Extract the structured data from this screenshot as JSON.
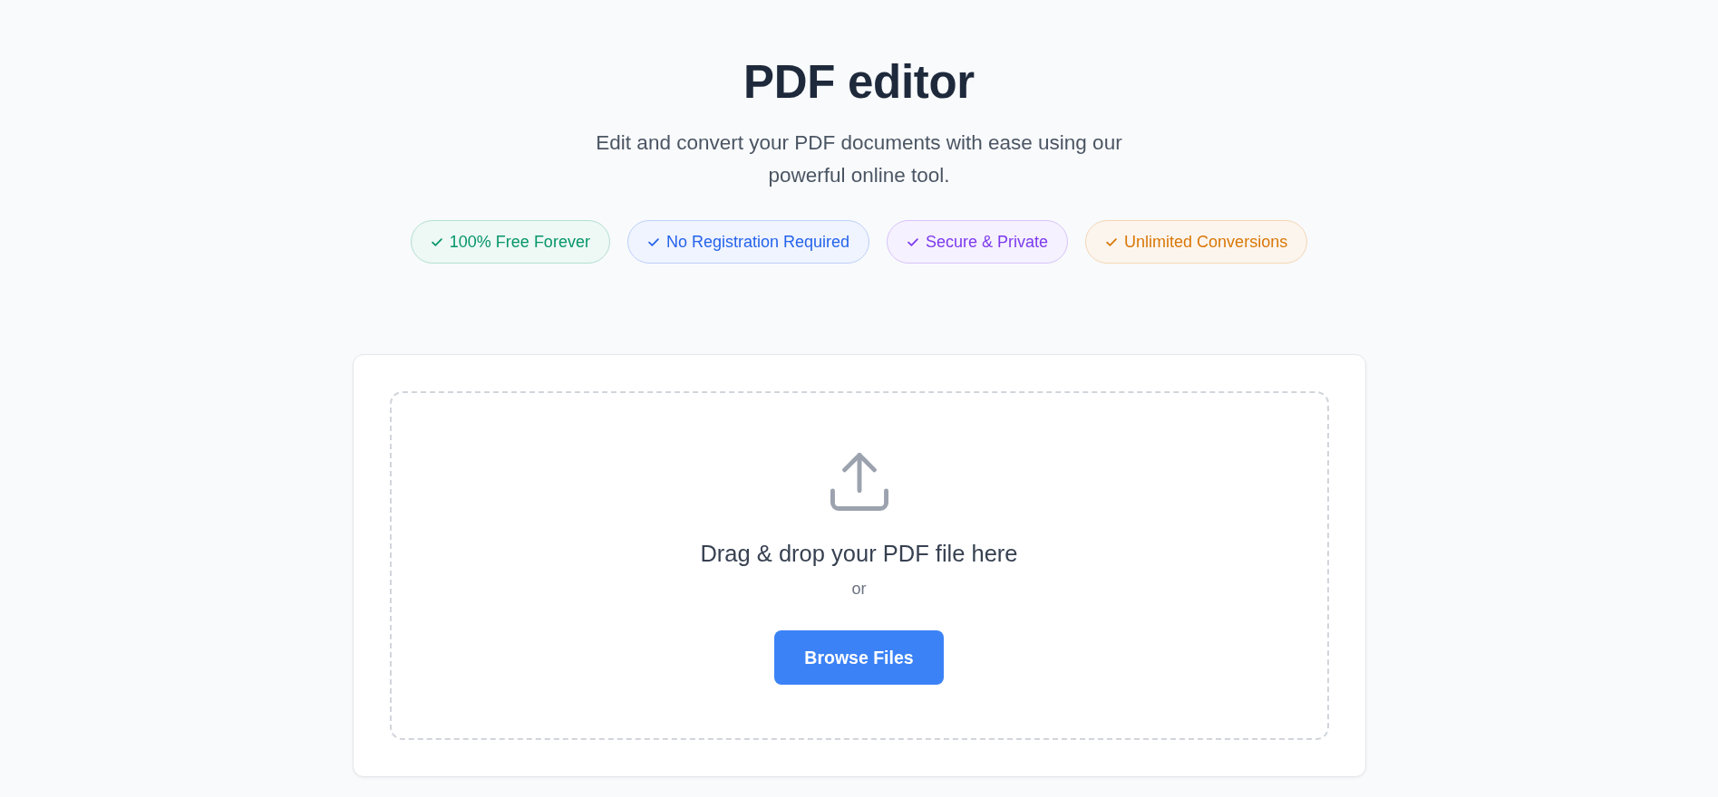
{
  "header": {
    "title": "PDF editor",
    "subtitle": "Edit and convert your PDF documents with ease using our powerful online tool."
  },
  "badges": [
    {
      "label": "100% Free Forever",
      "color": "#059669"
    },
    {
      "label": "No Registration Required",
      "color": "#2563eb"
    },
    {
      "label": "Secure & Private",
      "color": "#7c3aed"
    },
    {
      "label": "Unlimited Conversions",
      "color": "#d97706"
    }
  ],
  "upload": {
    "prompt": "Drag & drop your PDF file here",
    "separator": "or",
    "button": "Browse Files"
  }
}
